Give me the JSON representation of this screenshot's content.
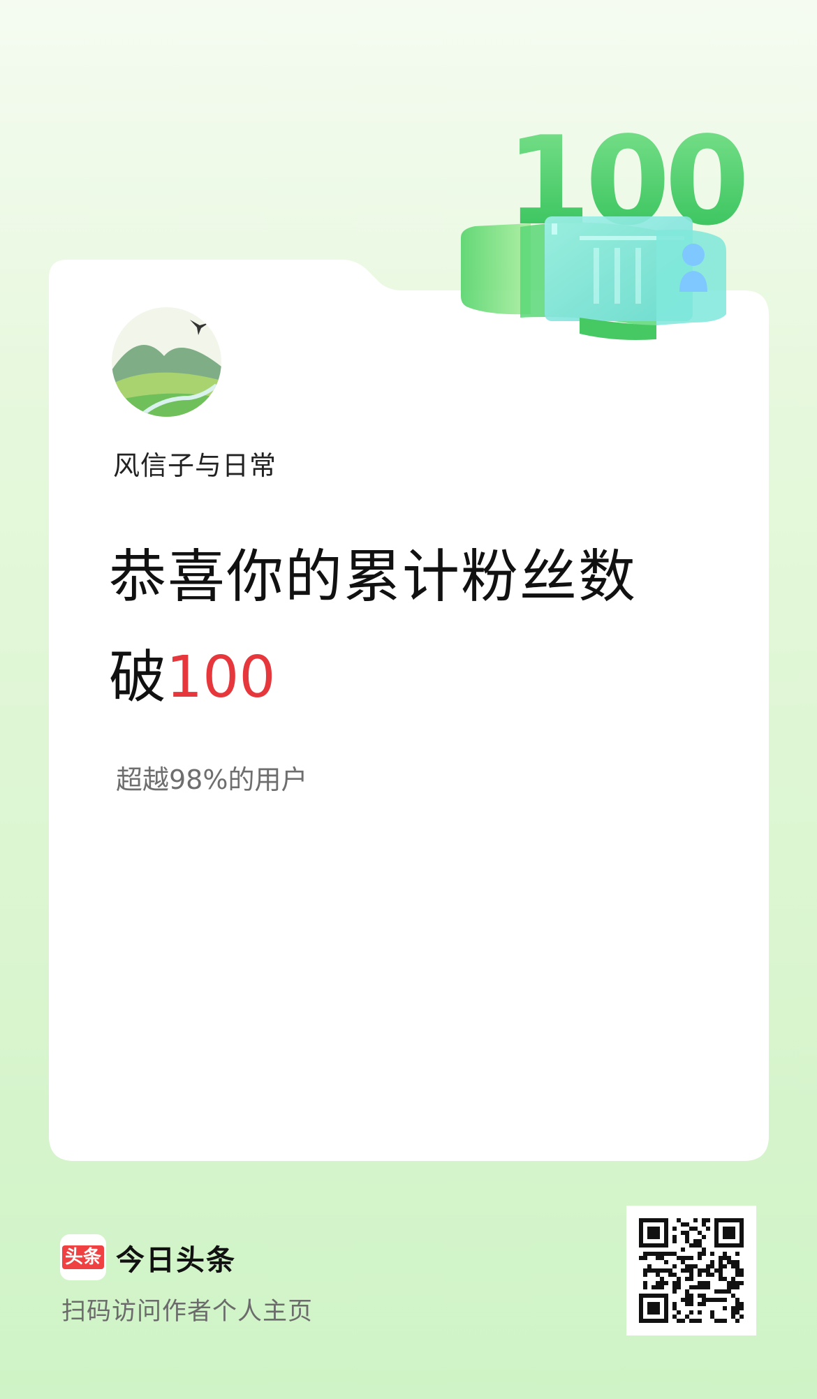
{
  "milestone": {
    "badge_number": "100"
  },
  "profile": {
    "username": "风信子与日常",
    "avatar": "landscape-avatar"
  },
  "headline": {
    "line1": "恭喜你的累计粉丝数",
    "line2_prefix": "破",
    "line2_value": "100"
  },
  "subtext": "超越98%的用户",
  "footer": {
    "brand_logo_text": "头条",
    "brand_name": "今日头条",
    "hint": "扫码访问作者个人主页"
  },
  "colors": {
    "highlight": "#e5373c",
    "badge_green": "#3fcf6a",
    "logo_red": "#f04142"
  }
}
